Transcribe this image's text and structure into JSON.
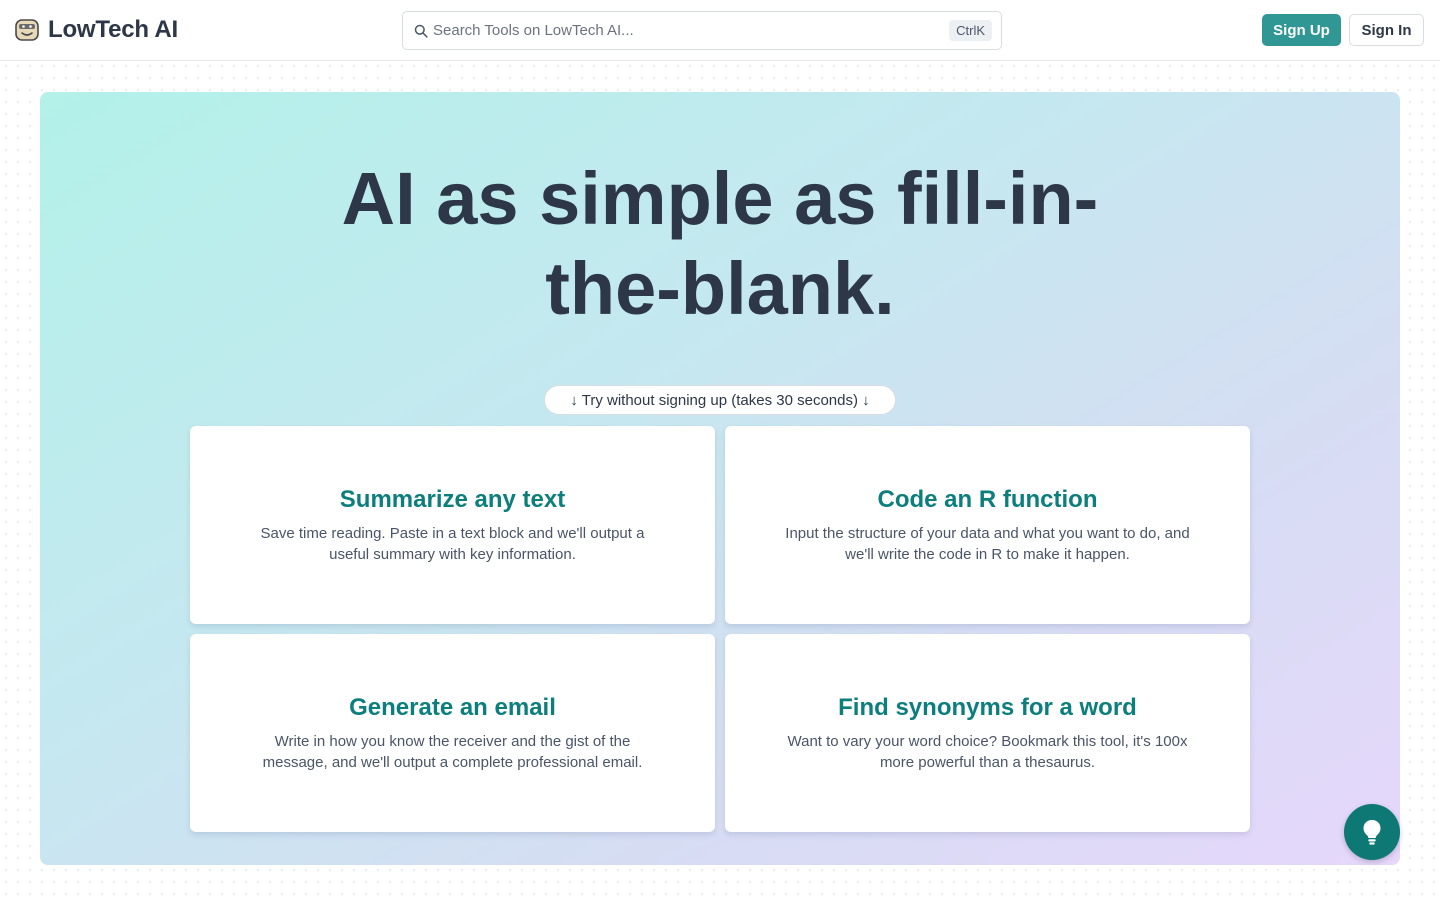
{
  "header": {
    "logo_text": "LowTech AI",
    "search_placeholder": "Search Tools on LowTech AI...",
    "search_shortcut": "CtrlK",
    "signup_label": "Sign Up",
    "signin_label": "Sign In"
  },
  "hero": {
    "title": "AI as simple as fill-in-the-blank.",
    "try_label": "↓ Try without signing up (takes 30 seconds) ↓"
  },
  "cards": [
    {
      "title": "Summarize any text",
      "description": "Save time reading. Paste in a text block and we'll output a useful summary with key information."
    },
    {
      "title": "Code an R function",
      "description": "Input the structure of your data and what you want to do, and we'll write the code in R to make it happen."
    },
    {
      "title": "Generate an email",
      "description": "Write in how you know the receiver and the gist of the message, and we'll output a complete professional email."
    },
    {
      "title": "Find synonyms for a word",
      "description": "Want to vary your word choice? Bookmark this tool, it's 100x more powerful than a thesaurus."
    }
  ],
  "icons": {
    "logo": "robot-face-icon",
    "search": "search-icon",
    "fab": "lightbulb-icon"
  },
  "colors": {
    "brand": "#319795",
    "card_title": "#0c7f7c",
    "fab": "#0e7874",
    "heading": "#2d3748"
  }
}
